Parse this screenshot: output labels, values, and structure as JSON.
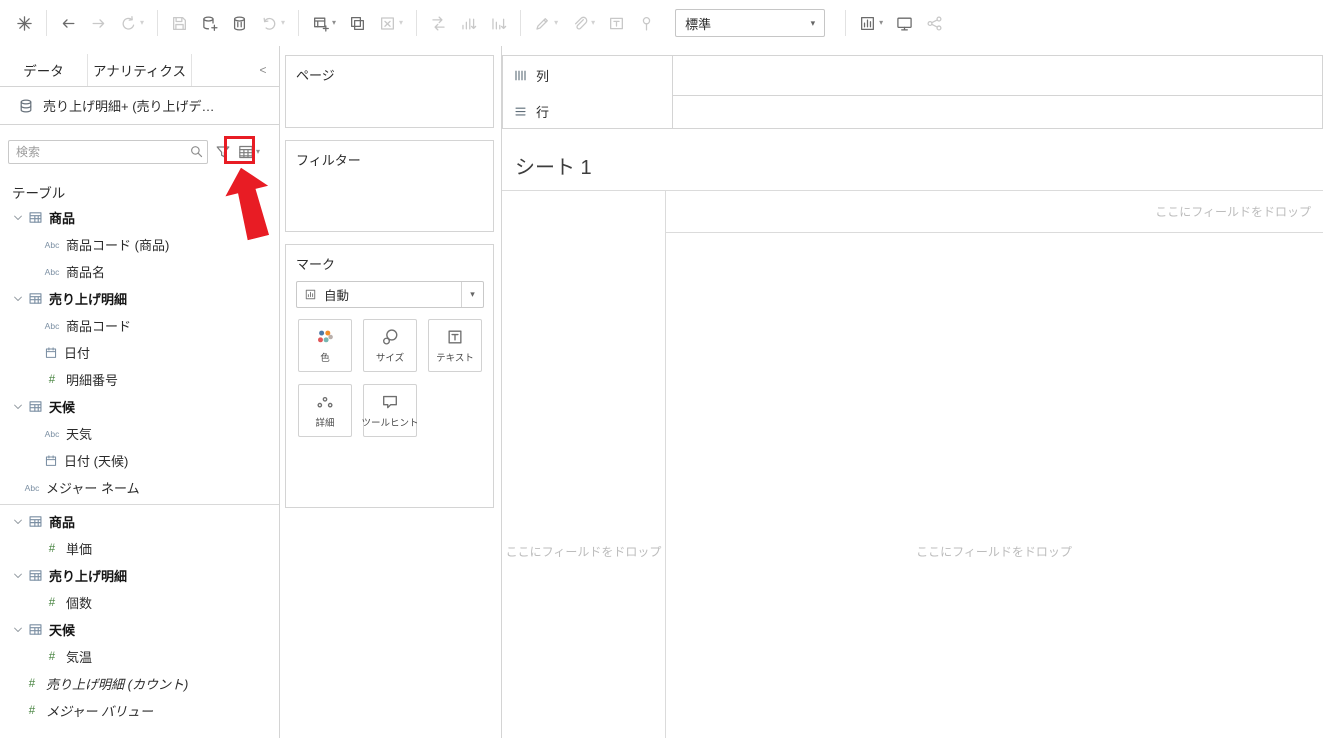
{
  "colors": {
    "highlight_red": "#e81c24",
    "border_gray": "#d4d4d4",
    "drop_hint_gray": "#bcbcbc"
  },
  "toolbar": {
    "fit_value": "標準",
    "buttons": [
      {
        "name": "tableau-logo-icon"
      },
      {
        "name": "separator"
      },
      {
        "name": "undo-icon"
      },
      {
        "name": "redo-icon",
        "disabled": true
      },
      {
        "name": "replay-icon",
        "caret": true,
        "disabled": true
      },
      {
        "name": "separator"
      },
      {
        "name": "save-icon",
        "disabled": true
      },
      {
        "name": "new-datasource-icon"
      },
      {
        "name": "pause-updates-icon"
      },
      {
        "name": "run-updates-icon",
        "caret": true,
        "disabled": true
      },
      {
        "name": "separator"
      },
      {
        "name": "new-worksheet-icon",
        "caret": true
      },
      {
        "name": "duplicate-icon"
      },
      {
        "name": "clear-sheet-icon",
        "caret": true,
        "disabled": true
      },
      {
        "name": "separator"
      },
      {
        "name": "swap-rows-columns-icon",
        "disabled": true
      },
      {
        "name": "sort-ascending-icon",
        "disabled": true
      },
      {
        "name": "sort-descending-icon",
        "disabled": true
      },
      {
        "name": "separator"
      },
      {
        "name": "highlight-icon",
        "caret": true,
        "disabled": true
      },
      {
        "name": "group-members-icon",
        "caret": true,
        "disabled": true
      },
      {
        "name": "show-mark-labels-icon",
        "disabled": true
      },
      {
        "name": "fix-axes-icon",
        "disabled": true
      },
      {
        "name": "fit-selector"
      },
      {
        "name": "separator"
      },
      {
        "name": "show-hide-cards-icon",
        "caret": true
      },
      {
        "name": "presentation-mode-icon"
      },
      {
        "name": "share-icon",
        "disabled": true
      }
    ]
  },
  "sidebar": {
    "tabs": [
      {
        "label": "データ",
        "active": true
      },
      {
        "label": "アナリティクス",
        "active": false
      }
    ],
    "collapse_label": "<",
    "datasource": "売り上げ明細+ (売り上げデ…",
    "search": {
      "placeholder": "検索"
    },
    "tables_heading": "テーブル",
    "fields": [
      {
        "kind": "table",
        "label": "商品"
      },
      {
        "kind": "field",
        "icon": "text-type-icon",
        "label": "商品コード (商品)",
        "indent": 1
      },
      {
        "kind": "field",
        "icon": "text-type-icon",
        "label": "商品名",
        "indent": 1
      },
      {
        "kind": "table",
        "label": "売り上げ明細"
      },
      {
        "kind": "field",
        "icon": "text-type-icon",
        "label": "商品コード",
        "indent": 1
      },
      {
        "kind": "field",
        "icon": "date-type-icon",
        "label": "日付",
        "indent": 1
      },
      {
        "kind": "field",
        "icon": "number-type-icon",
        "label": "明細番号",
        "indent": 1
      },
      {
        "kind": "table",
        "label": "天候"
      },
      {
        "kind": "field",
        "icon": "text-type-icon",
        "label": "天気",
        "indent": 1
      },
      {
        "kind": "field",
        "icon": "date-type-icon",
        "label": "日付 (天候)",
        "indent": 1
      },
      {
        "kind": "field",
        "icon": "text-type-icon",
        "label": "メジャー ネーム",
        "indent": 0
      },
      {
        "kind": "divider"
      },
      {
        "kind": "table",
        "label": "商品"
      },
      {
        "kind": "field",
        "icon": "number-type-icon",
        "label": "単価",
        "indent": 1
      },
      {
        "kind": "table",
        "label": "売り上げ明細"
      },
      {
        "kind": "field",
        "icon": "number-type-icon",
        "label": "個数",
        "indent": 1
      },
      {
        "kind": "table",
        "label": "天候"
      },
      {
        "kind": "field",
        "icon": "number-type-icon",
        "label": "気温",
        "indent": 1
      },
      {
        "kind": "field",
        "icon": "number-type-icon",
        "label": "売り上げ明細 (カウント)",
        "indent": 0,
        "italic": true
      },
      {
        "kind": "field",
        "icon": "number-type-icon",
        "label": "メジャー バリュー",
        "indent": 0,
        "italic": true
      }
    ]
  },
  "cards": {
    "pages": {
      "label": "ページ"
    },
    "filters": {
      "label": "フィルター"
    },
    "marks": {
      "label": "マーク",
      "type_selector": {
        "value": "自動",
        "icon": "automatic-mark-icon"
      },
      "buttons": [
        {
          "name": "color-button",
          "icon": "color-marks-icon",
          "label": "色"
        },
        {
          "name": "size-button",
          "icon": "size-marks-icon",
          "label": "サイズ"
        },
        {
          "name": "text-button",
          "icon": "text-marks-icon",
          "label": "テキスト"
        },
        {
          "name": "detail-button",
          "icon": "detail-marks-icon",
          "label": "詳細"
        },
        {
          "name": "tooltip-button",
          "icon": "tooltip-marks-icon",
          "label": "ツールヒント"
        }
      ]
    }
  },
  "shelves": {
    "columns": {
      "label": "列"
    },
    "rows": {
      "label": "行"
    }
  },
  "sheet": {
    "title": "シート 1",
    "drop_hint": "ここにフィールドをドロップ"
  }
}
